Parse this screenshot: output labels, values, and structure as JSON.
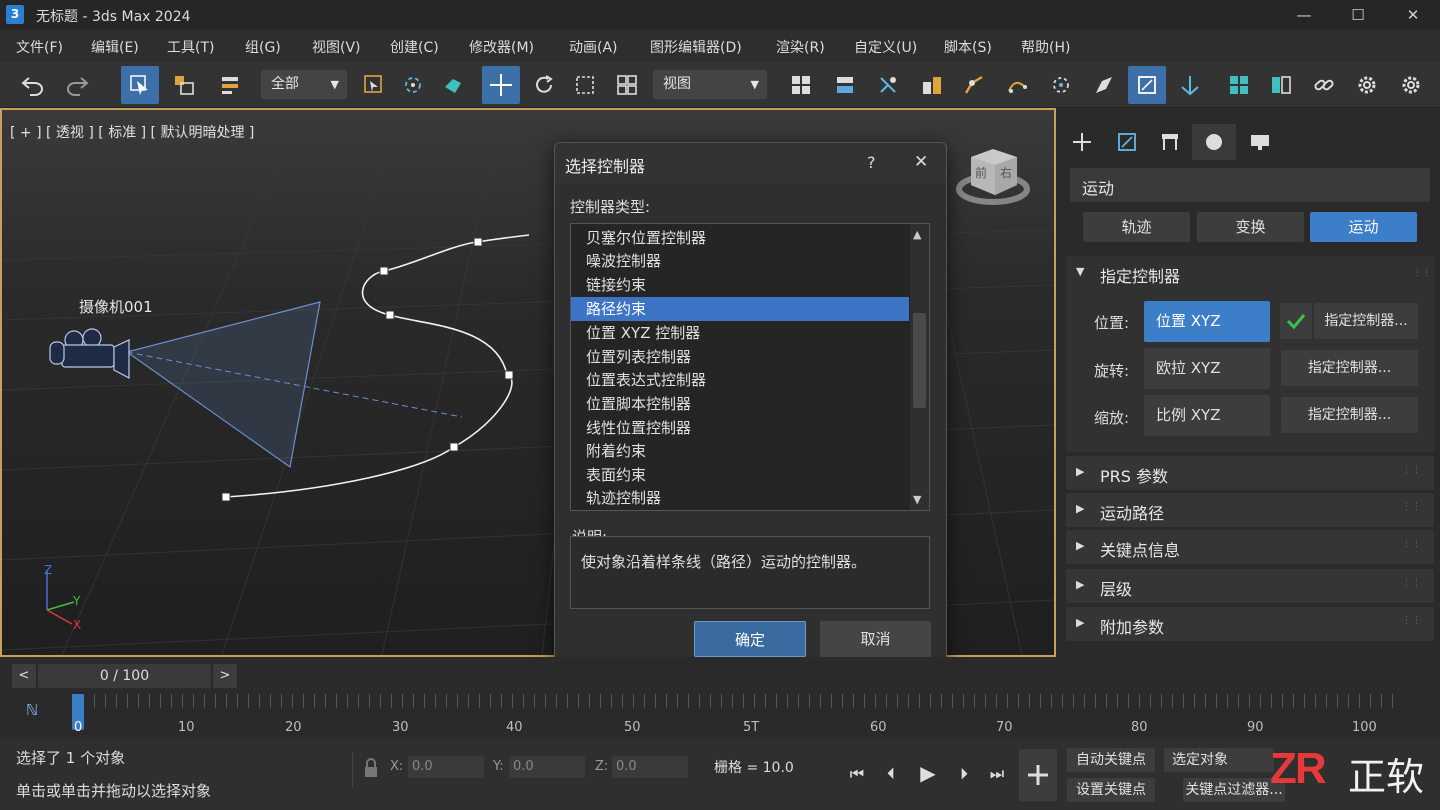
{
  "window": {
    "app_icon": "3",
    "title": "无标题   -  3ds Max 2024",
    "minimize": "—",
    "maximize": "☐",
    "close": "✕"
  },
  "menu": [
    "文件(F)",
    "编辑(E)",
    "工具(T)",
    "组(G)",
    "视图(V)",
    "创建(C)",
    "修改器(M)",
    "动画(A)",
    "图形编辑器(D)",
    "渲染(R)",
    "自定义(U)",
    "脚本(S)",
    "帮助(H)"
  ],
  "toolbar": {
    "selection_filter": "全部",
    "reference_coord": "视图"
  },
  "viewport": {
    "label": "[ + ]  [ 透视  ]  [ 标准  ]  [ 默认明暗处理  ]",
    "camera_name": "摄像机001",
    "viewcube_front": "前",
    "viewcube_right": "右",
    "axis_x": "X",
    "axis_y": "Y",
    "axis_z": "Z"
  },
  "panel": {
    "category": "运动",
    "tabs": [
      "轨迹",
      "变换",
      "运动"
    ],
    "assign_rollout": "指定控制器",
    "position_label": "位置:",
    "position_value": "位置 XYZ",
    "rotation_label": "旋转:",
    "rotation_value": "欧拉 XYZ",
    "scale_label": "缩放:",
    "scale_value": "比例 XYZ",
    "assign_button": "指定控制器...",
    "rollouts": [
      "PRS 参数",
      "运动路径",
      "关键点信息",
      "层级",
      "附加参数"
    ]
  },
  "dialog": {
    "title": "选择控制器",
    "help": "?",
    "close": "✕",
    "type_label": "控制器类型:",
    "items": [
      "贝塞尔位置控制器",
      "噪波控制器",
      "链接约束",
      "路径约束",
      "位置 XYZ 控制器",
      "位置列表控制器",
      "位置表达式控制器",
      "位置脚本控制器",
      "线性位置控制器",
      "附着约束",
      "表面约束",
      "轨迹控制器"
    ],
    "selected_index": 3,
    "desc_label": "说明:",
    "description": "使对象沿着样条线（路径）运动的控制器。",
    "ok": "确定",
    "cancel": "取消"
  },
  "timeline": {
    "frame_display": "0 / 100",
    "prev": "<",
    "next": ">",
    "ticks": [
      "0",
      "10",
      "20",
      "30",
      "40",
      "50",
      "5T",
      "60",
      "70",
      "80",
      "90",
      "100"
    ]
  },
  "status": {
    "selected": "选择了  1  个对象",
    "hint": "单击或单击并拖动以选择对象",
    "x_label": "X:",
    "x_value": "0.0",
    "y_label": "Y:",
    "y_value": "0.0",
    "z_label": "Z:",
    "z_value": "0.0",
    "grid": "栅格 = 10.0",
    "auto_key": "自动关键点",
    "selected_obj": "选定对象",
    "set_key": "设置关键点",
    "key_filter": "关键点过滤器...",
    "watermark_brand": "ZR",
    "watermark_text": "正软"
  },
  "colors": {
    "accent": "#3d7ec8",
    "viewport_border": "#c5a15a",
    "check": "#39c14a"
  }
}
